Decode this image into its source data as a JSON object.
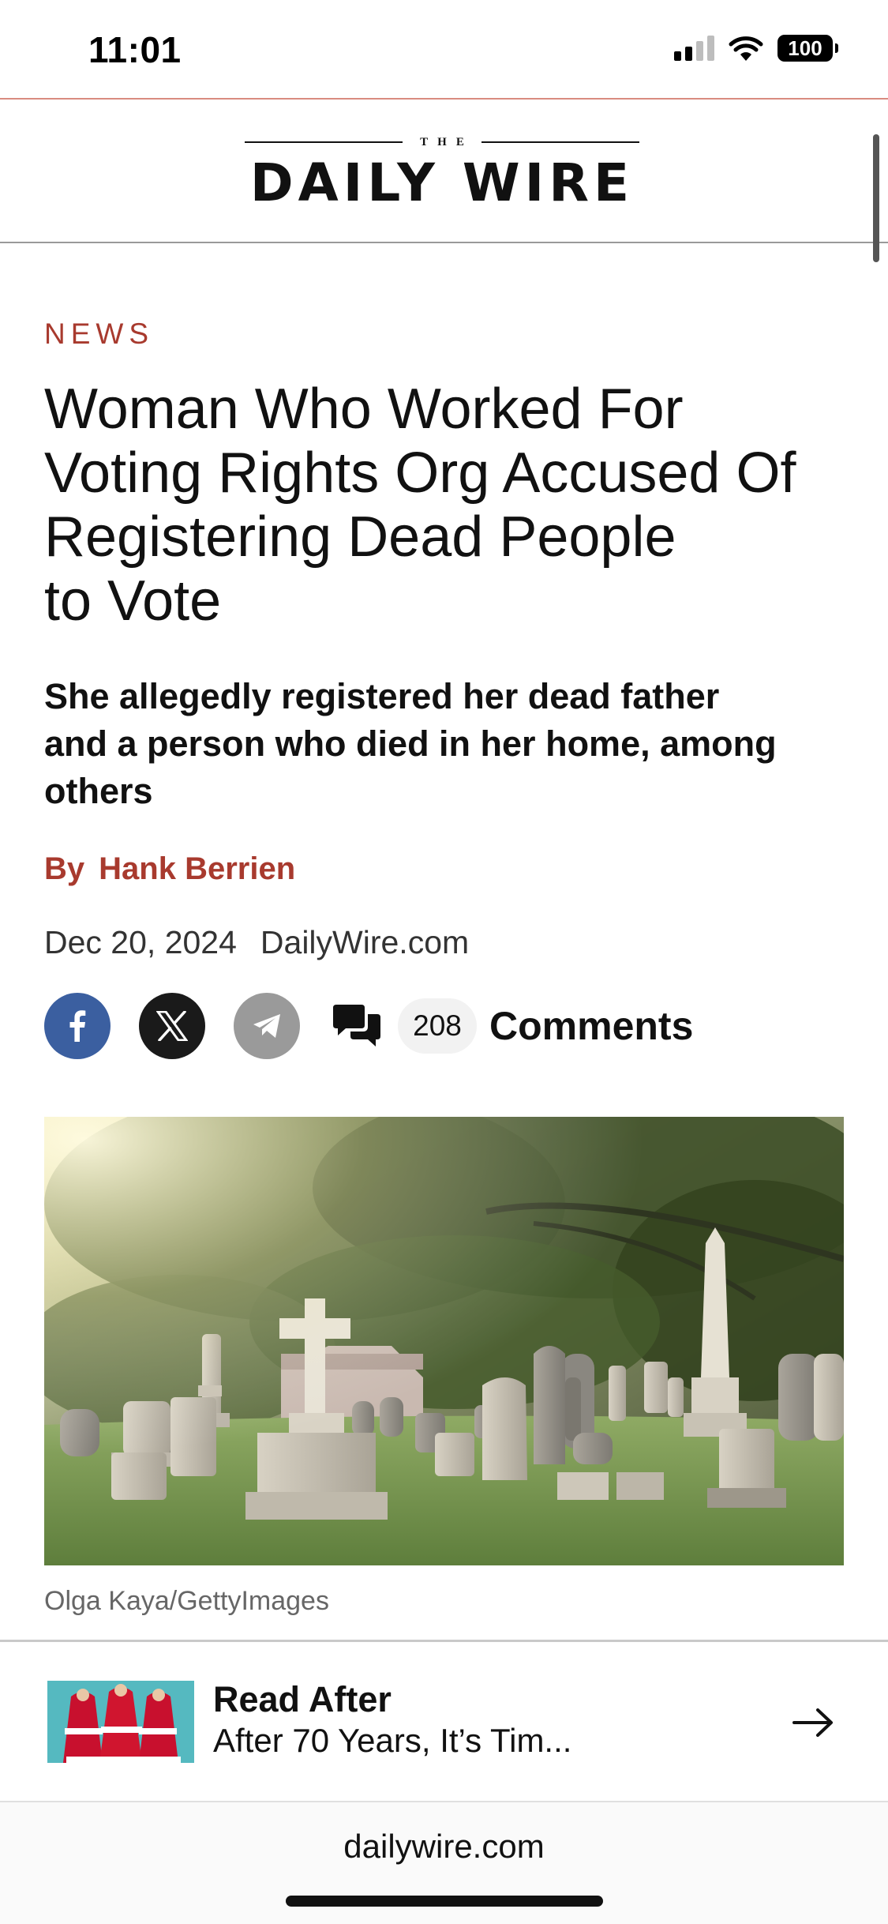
{
  "status_bar": {
    "time": "11:01",
    "battery": "100",
    "icons": [
      "cellular-signal-icon",
      "wifi-icon",
      "battery-icon"
    ]
  },
  "masthead": {
    "logo_small": "THE",
    "logo_main": "DAILY WIRE"
  },
  "article": {
    "kicker": "NEWS",
    "headline_lines": [
      "Woman Who Worked For",
      "Voting Rights Org Accused Of",
      "Registering Dead People",
      "to Vote"
    ],
    "subhead_lines": [
      "She allegedly registered her dead father",
      "and a person who died in her home, among",
      "others"
    ],
    "byline_prefix": "By",
    "author": "Hank Berrien",
    "date": "Dec 20, 2024",
    "source": "DailyWire.com",
    "share": {
      "facebook_icon": "facebook-icon",
      "x_icon": "x-icon",
      "telegram_icon": "telegram-icon",
      "comment_count": "208",
      "comments_label": "Comments"
    },
    "image_caption": "Olga Kaya/GettyImages"
  },
  "read_after": {
    "title": "Read After",
    "text": "After 70 Years, It’s Tim..."
  },
  "url_bar": {
    "url": "dailywire.com"
  },
  "colors": {
    "accent_red": "#a83a2e",
    "facebook_blue": "#3b5fa0",
    "x_black": "#1a1a1a",
    "telegram_gray": "#9a9a9a"
  }
}
